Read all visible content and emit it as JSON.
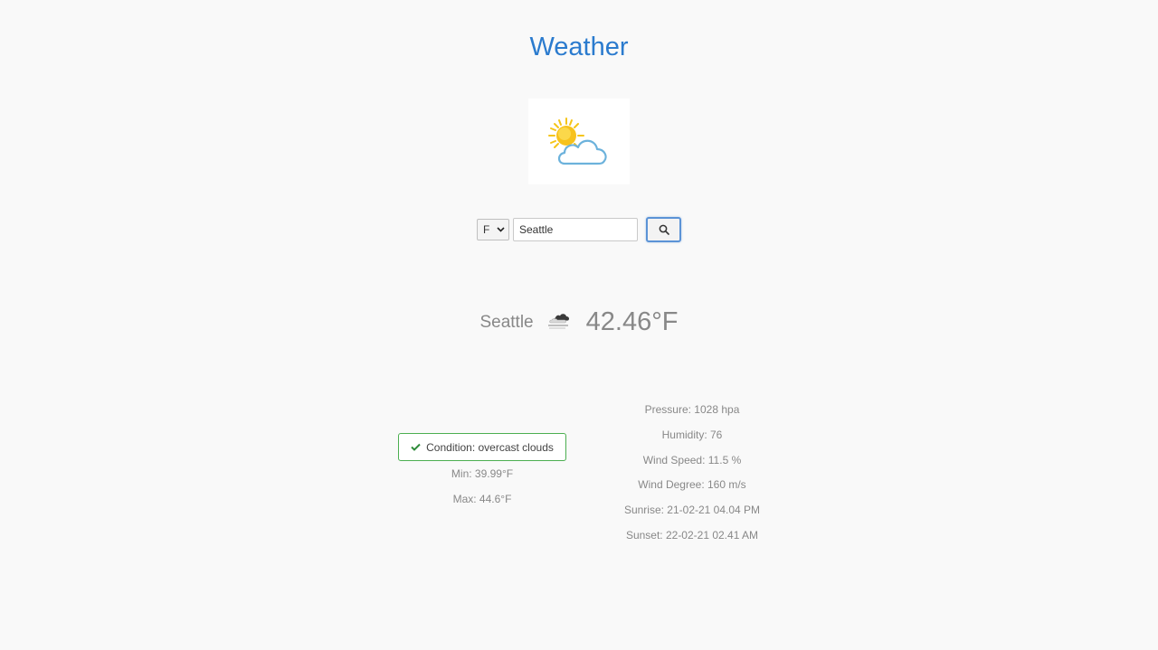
{
  "header": {
    "title": "Weather"
  },
  "logo": {
    "icon": "sun-cloud-logo-icon"
  },
  "search": {
    "unit_value": "F",
    "city_value": "Seattle",
    "search_icon": "search-icon"
  },
  "current": {
    "city": "Seattle",
    "icon": "overcast-clouds-icon",
    "temperature": "42.46°F"
  },
  "condition": {
    "label": "Condition: overcast clouds"
  },
  "minmax": {
    "min": "Min: 39.99°F",
    "max": "Max: 44.6°F"
  },
  "details": {
    "pressure": "Pressure: 1028 hpa",
    "humidity": "Humidity: 76",
    "wind_speed": "Wind Speed: 11.5 %",
    "wind_degree": "Wind Degree: 160 m/s",
    "sunrise": "Sunrise: 21-02-21 04.04 PM",
    "sunset": "Sunset: 22-02-21 02.41 AM"
  },
  "colors": {
    "accent": "#2b7bce",
    "success": "#4caf50",
    "text_muted": "#888888",
    "background": "#f9f9f9"
  }
}
